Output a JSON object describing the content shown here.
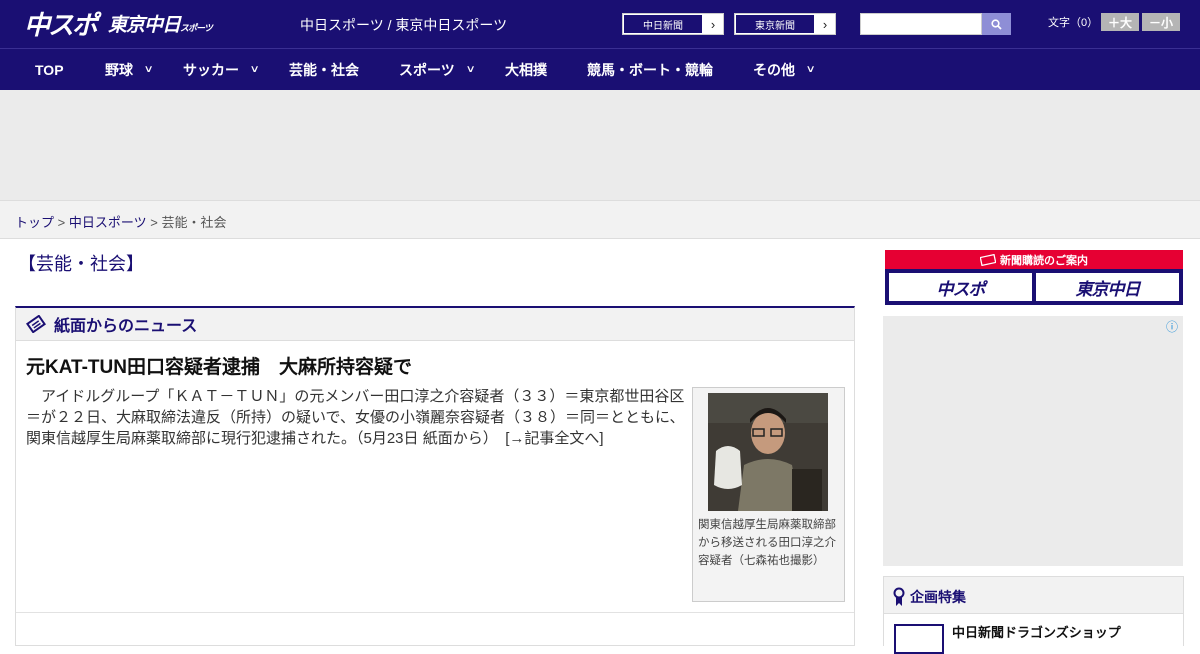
{
  "header": {
    "logo_main": "中スポ",
    "logo_sub": "東京中日",
    "logo_sub_small": "スポーツ",
    "site_name": "中日スポーツ / 東京中日スポーツ",
    "paper_links": [
      {
        "label": "中日新聞",
        "arrow": "›"
      },
      {
        "label": "東京新聞",
        "arrow": "›"
      }
    ],
    "search": {
      "placeholder": "",
      "icon": "search-icon"
    },
    "font_label": "文字（0）",
    "font_larger": "＋大",
    "font_smaller": "－小"
  },
  "nav": {
    "items": [
      {
        "label": "TOP",
        "dropdown": false
      },
      {
        "label": "野球",
        "dropdown": true
      },
      {
        "label": "サッカー",
        "dropdown": true
      },
      {
        "label": "芸能・社会",
        "dropdown": false
      },
      {
        "label": "スポーツ",
        "dropdown": true
      },
      {
        "label": "大相撲",
        "dropdown": false
      },
      {
        "label": "競馬・ボート・競輪",
        "dropdown": false
      },
      {
        "label": "その他",
        "dropdown": true
      }
    ]
  },
  "breadcrumb": {
    "items": [
      "トップ",
      "中日スポーツ",
      "芸能・社会"
    ],
    "separator": ">"
  },
  "section_title": "【芸能・社会】",
  "news": {
    "heading": "紙面からのニュース",
    "article": {
      "title": "元KAT-TUN田口容疑者逮捕　大麻所持容疑で",
      "body": "アイドルグループ「ＫＡＴ－ＴＵＮ」の元メンバー田口淳之介容疑者（３３）＝東京都世田谷区＝が２２日、大麻取締法違反（所持）の疑いで、女優の小嶺麗奈容疑者（３８）＝同＝とともに、関東信越厚生局麻薬取締部に現行犯逮捕された。（5月23日 紙面から）　[→記事全文へ]",
      "caption": "関東信越厚生局麻薬取締部から移送される田口淳之介容疑者（七森祐也撮影）"
    }
  },
  "sidebar": {
    "subscribe_banner": "新聞購読のご案内",
    "subscribe_left": "中スポ",
    "subscribe_right": "東京中日",
    "ad_info": "ⓘ",
    "feature_heading": "企画特集",
    "feature_item": "中日新聞ドラゴンズショップ"
  },
  "colors": {
    "brand": "#1a0f73",
    "accent_red": "#e60033"
  }
}
